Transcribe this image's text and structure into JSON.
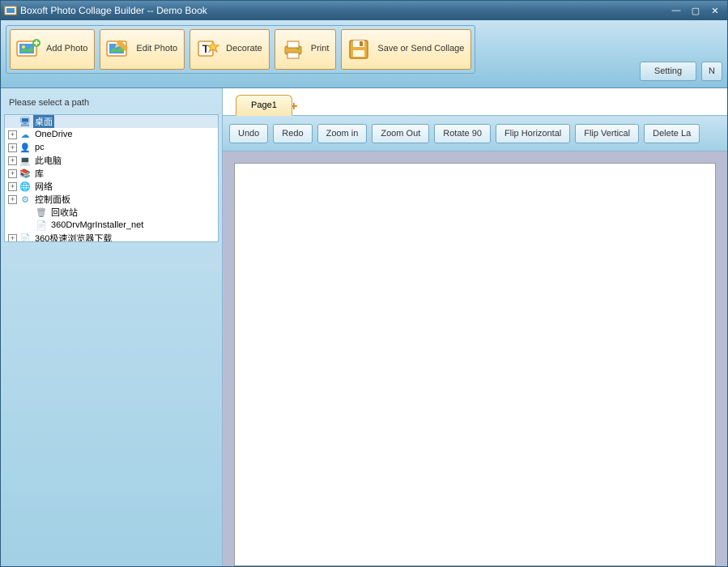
{
  "titlebar": {
    "title": "Boxoft Photo Collage Builder -- Demo Book"
  },
  "toolbar": {
    "add_photo": "Add Photo",
    "edit_photo": "Edit Photo",
    "decorate": "Decorate",
    "print": "Print",
    "save_send": "Save or Send Collage",
    "setting": "Setting",
    "next": "N"
  },
  "left": {
    "label": "Please select a path"
  },
  "tree": [
    {
      "indent": 0,
      "expander": "none",
      "icon": "desktop",
      "label": "桌面",
      "selected": true
    },
    {
      "indent": 0,
      "expander": "plus",
      "icon": "cloud",
      "label": "OneDrive"
    },
    {
      "indent": 0,
      "expander": "plus",
      "icon": "user",
      "label": "pc"
    },
    {
      "indent": 0,
      "expander": "plus",
      "icon": "computer",
      "label": "此电脑"
    },
    {
      "indent": 0,
      "expander": "plus",
      "icon": "library",
      "label": "库"
    },
    {
      "indent": 0,
      "expander": "plus",
      "icon": "network",
      "label": "网络"
    },
    {
      "indent": 0,
      "expander": "plus",
      "icon": "control",
      "label": "控制面板"
    },
    {
      "indent": 1,
      "expander": "none",
      "icon": "recycle",
      "label": "回收站"
    },
    {
      "indent": 1,
      "expander": "none",
      "icon": "file",
      "label": "360DrvMgrInstaller_net"
    },
    {
      "indent": 0,
      "expander": "plus",
      "icon": "file",
      "label": "360极速浏览器下载"
    }
  ],
  "tabs": {
    "page1": "Page1"
  },
  "actions": {
    "undo": "Undo",
    "redo": "Redo",
    "zoom_in": "Zoom in",
    "zoom_out": "Zoom Out",
    "rotate90": "Rotate 90",
    "flip_h": "Flip Horizontal",
    "flip_v": "Flip Vertical",
    "delete": "Delete La"
  },
  "icons": {
    "desktop": "🖥",
    "cloud": "☁",
    "user": "👤",
    "computer": "💻",
    "library": "📚",
    "network": "🌐",
    "control": "⚙",
    "recycle": "🗑",
    "file": "📄"
  }
}
